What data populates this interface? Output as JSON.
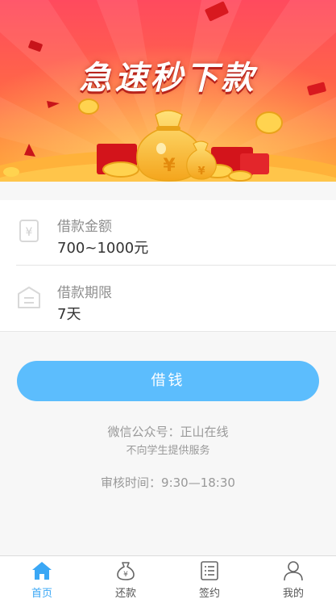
{
  "banner": {
    "title": "急速秒下款"
  },
  "loan_amount": {
    "label": "借款金额",
    "value": "700~1000元"
  },
  "loan_term": {
    "label": "借款期限",
    "value": "7天"
  },
  "borrow_button": {
    "label": "借钱"
  },
  "info": {
    "wechat": "微信公众号：正山在线",
    "notice": "不向学生提供服务",
    "hours": "审核时间：9:30—18:30"
  },
  "tabbar": {
    "items": [
      {
        "label": "首页",
        "icon": "home-icon",
        "active": true
      },
      {
        "label": "还款",
        "icon": "money-bag-icon",
        "active": false
      },
      {
        "label": "签约",
        "icon": "document-list-icon",
        "active": false
      },
      {
        "label": "我的",
        "icon": "user-icon",
        "active": false
      }
    ]
  },
  "colors": {
    "accent": "#5cbdfd",
    "tab_active": "#3aa7f5",
    "banner_top": "#ff4f5e",
    "banner_bottom": "#ff8a2a"
  }
}
